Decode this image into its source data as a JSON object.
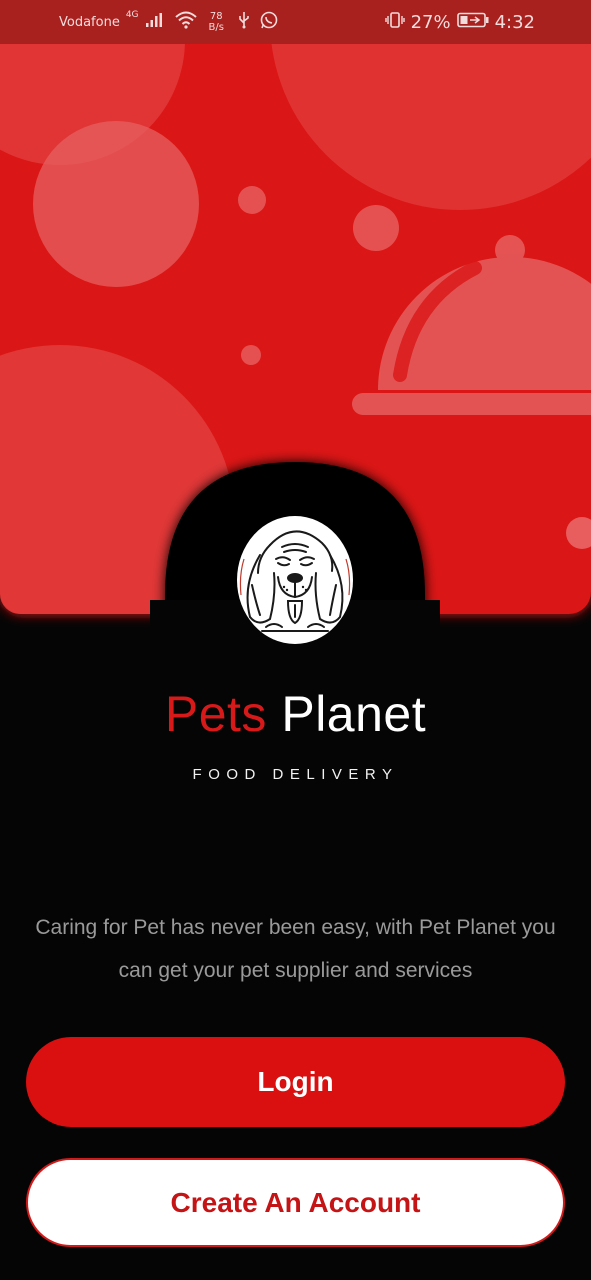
{
  "status_bar": {
    "carrier": "Vodafone",
    "network": "4G",
    "speed_value": "78",
    "speed_unit": "B/s",
    "battery_percent": "27%",
    "time": "4:32",
    "icons": [
      "signal-icon",
      "wifi-icon",
      "usb-icon",
      "whatsapp-icon",
      "vibrate-icon",
      "battery-charging-icon"
    ]
  },
  "brand": {
    "name_part1": "Pets",
    "name_part2": "Planet",
    "tagline": "FOOD DELIVERY",
    "logo_icon": "dog-logo-icon"
  },
  "intro": {
    "description": "Caring for Pet has never been easy, with Pet Planet you can get your pet supplier and services"
  },
  "actions": {
    "login_label": "Login",
    "create_account_label": "Create An Account"
  },
  "colors": {
    "brand_red": "#d90f10",
    "background": "#050505",
    "status_bar": "#a8211f"
  }
}
